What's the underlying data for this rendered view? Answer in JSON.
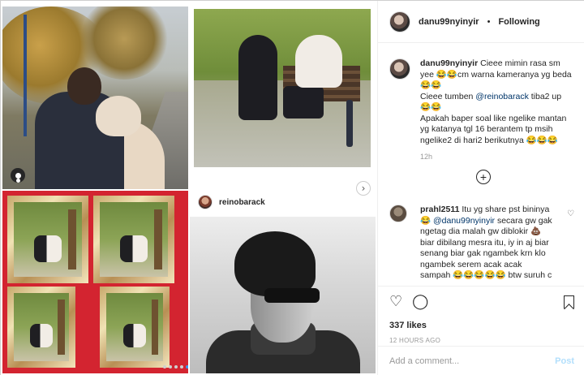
{
  "post": {
    "author": "danu99nyinyir",
    "separator": "•",
    "follow_status": "Following"
  },
  "comments": [
    {
      "author": "danu99nyinyir",
      "lines": [
        "Cieee mimin rasa sm",
        "yee 😂😂cm warna kameranya yg beda",
        "😂😂",
        "Cieee tumben",
        "tiba2 up",
        "😂😂",
        "Apakah baper soal like ngelike mantan",
        "yg katanya tgl 16 berantem tp msih",
        "ngelike2 di hari2 berikutnya 😂😂😂"
      ],
      "mention": "@reinobarack",
      "time": "12h"
    },
    {
      "author": "prahl2511",
      "first": "Itu yg share pst bininya",
      "mention": "@danu99nyinyir",
      "lines": [
        "😂",
        "secara gw gak",
        "ngetag dia malah gw diblokir 💩",
        "biar dibilang mesra itu, iy in aj biar",
        "senang biar gak ngambek krn klo",
        "ngambek serem acak acak",
        "sampah 😂😂😂😂😂 btw suruh c"
      ]
    }
  ],
  "embedded": {
    "username": "reinobarack"
  },
  "actions": {
    "likes": "337 likes",
    "posted": "12 HOURS AGO",
    "add_comment_placeholder": "Add a comment...",
    "post_label": "Post",
    "load_more": "+"
  },
  "icons": {
    "heart": "heart-icon",
    "comment": "comment-icon",
    "bookmark": "bookmark-icon",
    "user_tag": "user-tag-icon",
    "next": "chevron-right-icon"
  },
  "colors": {
    "mention": "#003569",
    "post_disabled": "#b2dffc",
    "carousel_active": "#3897f0"
  }
}
